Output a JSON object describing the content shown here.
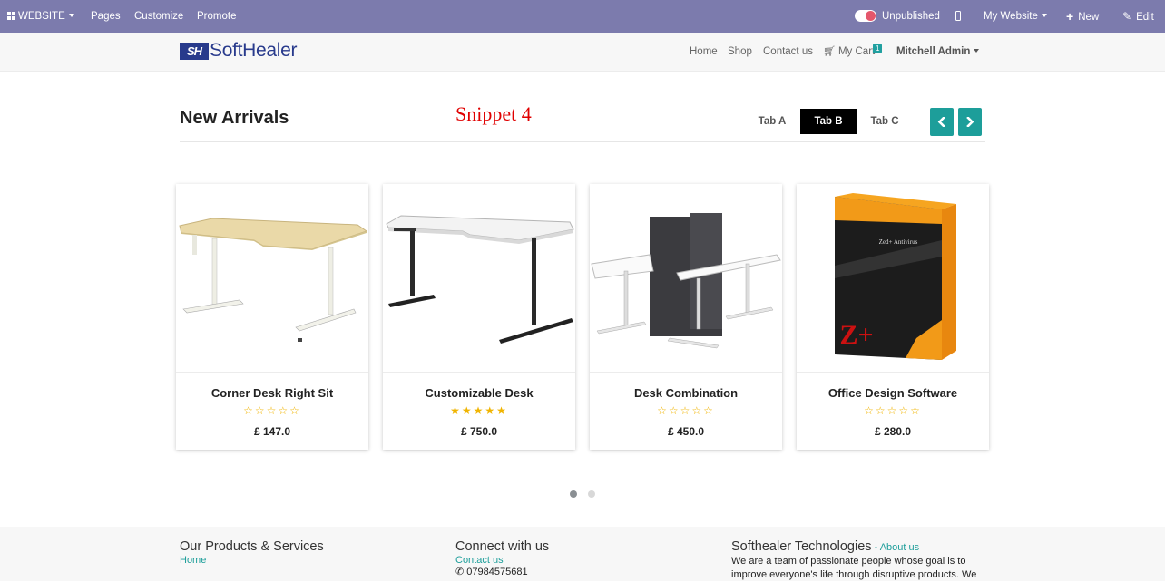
{
  "admin_bar": {
    "website_label": "WEBSITE",
    "pages": "Pages",
    "customize": "Customize",
    "promote": "Promote",
    "unpublished": "Unpublished",
    "my_website": "My Website",
    "new": "New",
    "edit": "Edit"
  },
  "header": {
    "logo_mark": "SH",
    "logo_text": "SoftHealer",
    "nav": [
      "Home",
      "Shop",
      "Contact us"
    ],
    "cart_label": "My Cart",
    "cart_count": "1",
    "user": "Mitchell Admin"
  },
  "section": {
    "title": "New Arrivals",
    "snippet_label": "Snippet 4",
    "tabs": [
      "Tab A",
      "Tab B",
      "Tab C"
    ],
    "active_tab": "Tab B"
  },
  "products": [
    {
      "name": "Corner Desk Right Sit",
      "rating": 0,
      "stars": "☆☆☆☆☆",
      "price": "£ 147.0"
    },
    {
      "name": "Customizable Desk",
      "rating": 5,
      "stars": "★★★★★",
      "price": "£ 750.0"
    },
    {
      "name": "Desk Combination",
      "rating": 0,
      "stars": "☆☆☆☆☆",
      "price": "£ 450.0"
    },
    {
      "name": "Office Design Software",
      "rating": 0,
      "stars": "☆☆☆☆☆",
      "price": "£ 280.0",
      "box_text": "Zed+ Antivirus",
      "box_logo": "Z+"
    }
  ],
  "carousel": {
    "pages": 2,
    "active_page": 1
  },
  "footer": {
    "col1_title": "Our Products & Services",
    "col1_link": "Home",
    "col2_title": "Connect with us",
    "col2_link": "Contact us",
    "phone": "07984575681",
    "col3_title": "Softhealer Technologies",
    "col3_sep": " - ",
    "col3_link": "About us",
    "col3_line1": "We are a team of passionate people whose goal is to",
    "col3_line2": "improve everyone's life through disruptive products. We"
  },
  "colors": {
    "admin_bar": "#7c7bad",
    "accent": "#1d9e9a",
    "brand": "#283a8c",
    "snippet_label": "#e00000",
    "star": "#f0b400"
  }
}
